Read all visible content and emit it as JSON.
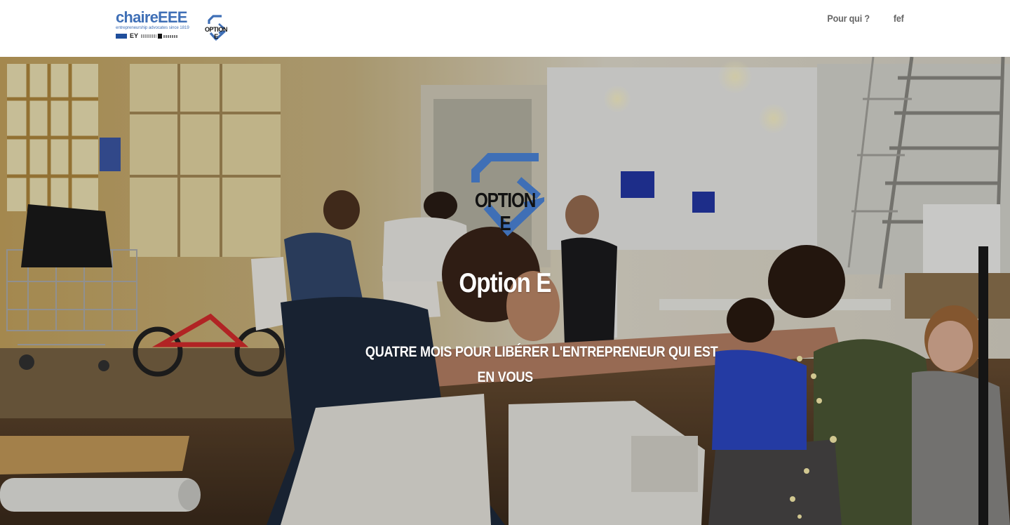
{
  "header": {
    "brand_name": "chaireEEE",
    "brand_tagline": "entrepreneurship advocates since 1819",
    "brand_sponsor": "EY",
    "option_logo_text": "OPTION E",
    "nav": [
      {
        "label": "Pour qui ?"
      },
      {
        "label": "fef"
      }
    ]
  },
  "hero": {
    "logo_text": "OPTION E",
    "title": "Option E",
    "subtitle_line1": "QUATRE MOIS POUR LIBÉRER L'ENTREPRENEUR QUI EST",
    "subtitle_line2": "EN VOUS"
  },
  "colors": {
    "brand_blue": "#3f6fb6",
    "nav_text": "#666666",
    "hero_text": "#ffffff"
  },
  "icons": {
    "option_logo": "option-e-logo-icon"
  }
}
